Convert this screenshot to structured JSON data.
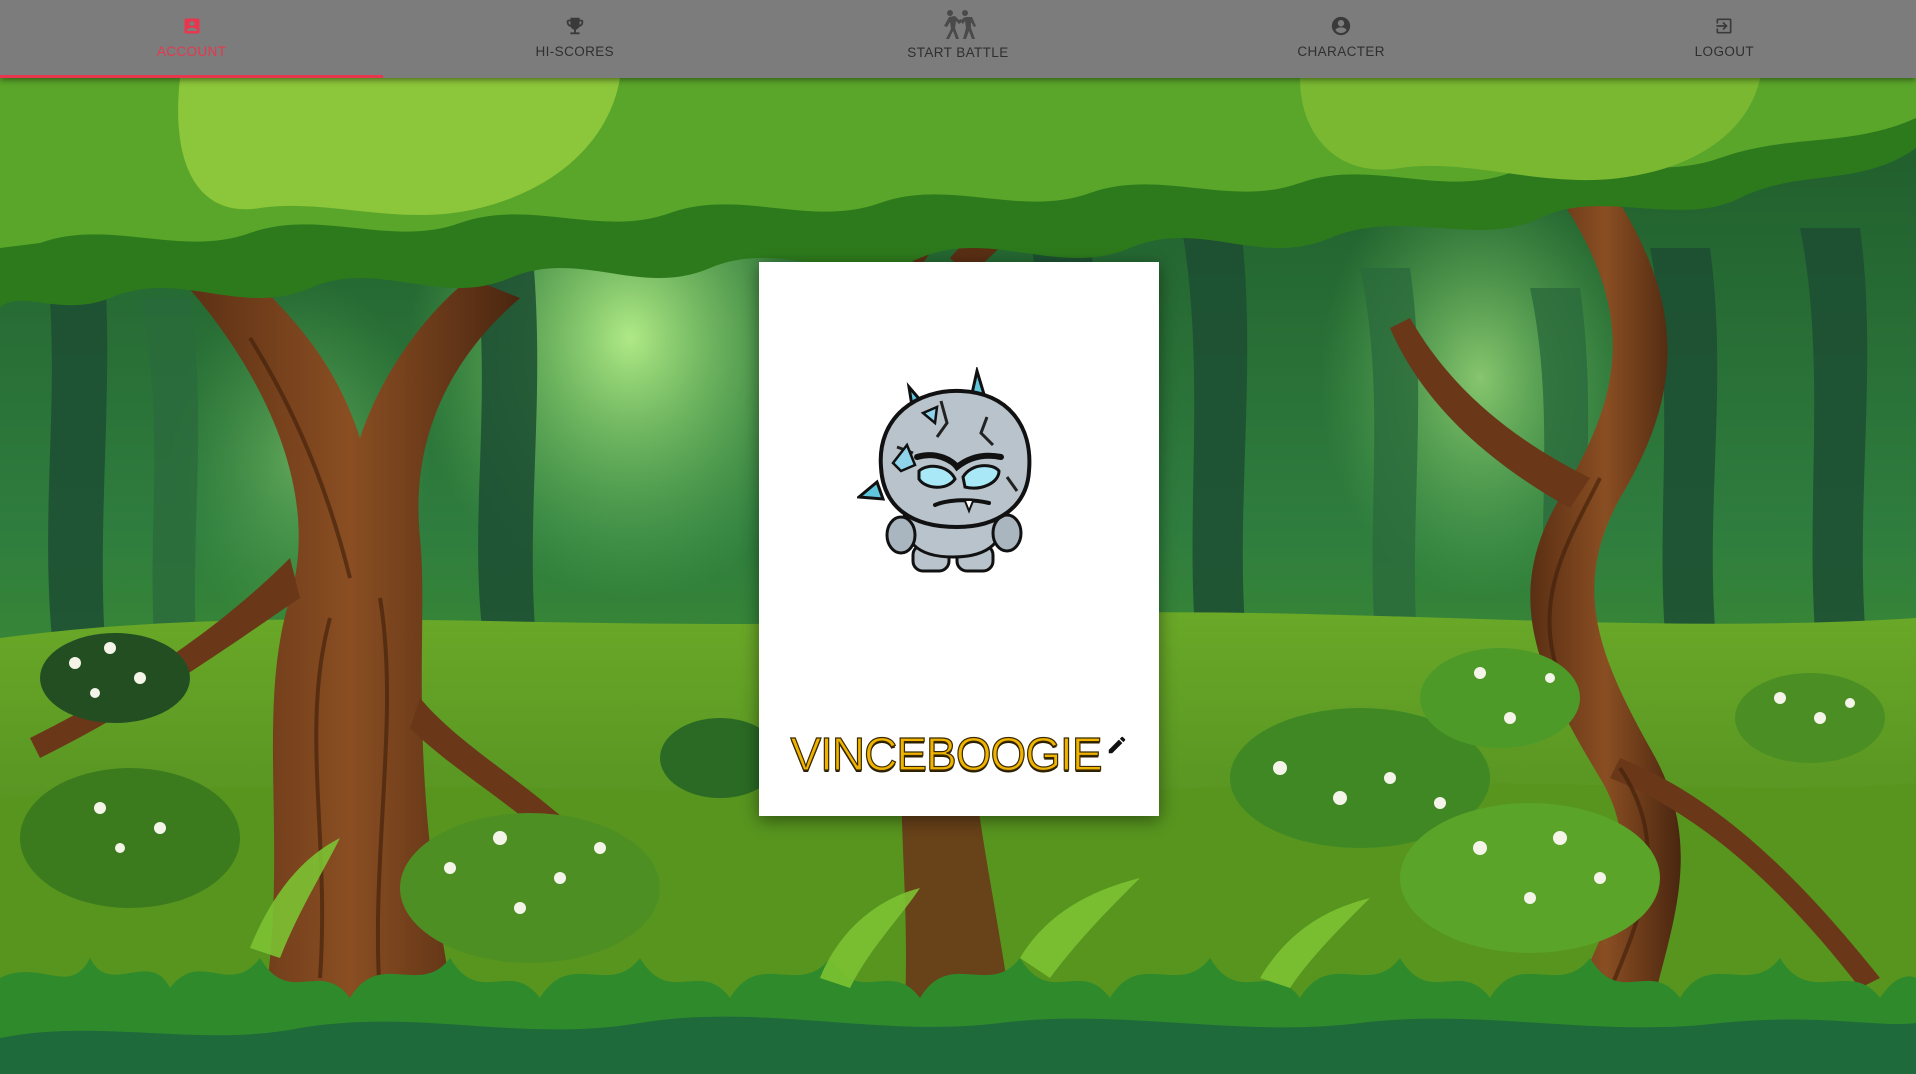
{
  "nav": {
    "tabs": [
      {
        "label": "ACCOUNT",
        "icon": "account-box-icon",
        "active": true
      },
      {
        "label": "HI-SCORES",
        "icon": "trophy-icon",
        "active": false
      },
      {
        "label": "START BATTLE",
        "icon": "fighters-icon",
        "active": false
      },
      {
        "label": "CHARACTER",
        "icon": "account-circle-icon",
        "active": false
      },
      {
        "label": "LOGOUT",
        "icon": "exit-icon",
        "active": false
      }
    ]
  },
  "profile": {
    "username": "VINCEBOOGIE",
    "avatar": "ice-golem-character",
    "edit_icon": "pencil-icon"
  },
  "colors": {
    "accent": "#e8364e",
    "nav_bg": "#7c7c7c",
    "username": "#f0b400"
  }
}
